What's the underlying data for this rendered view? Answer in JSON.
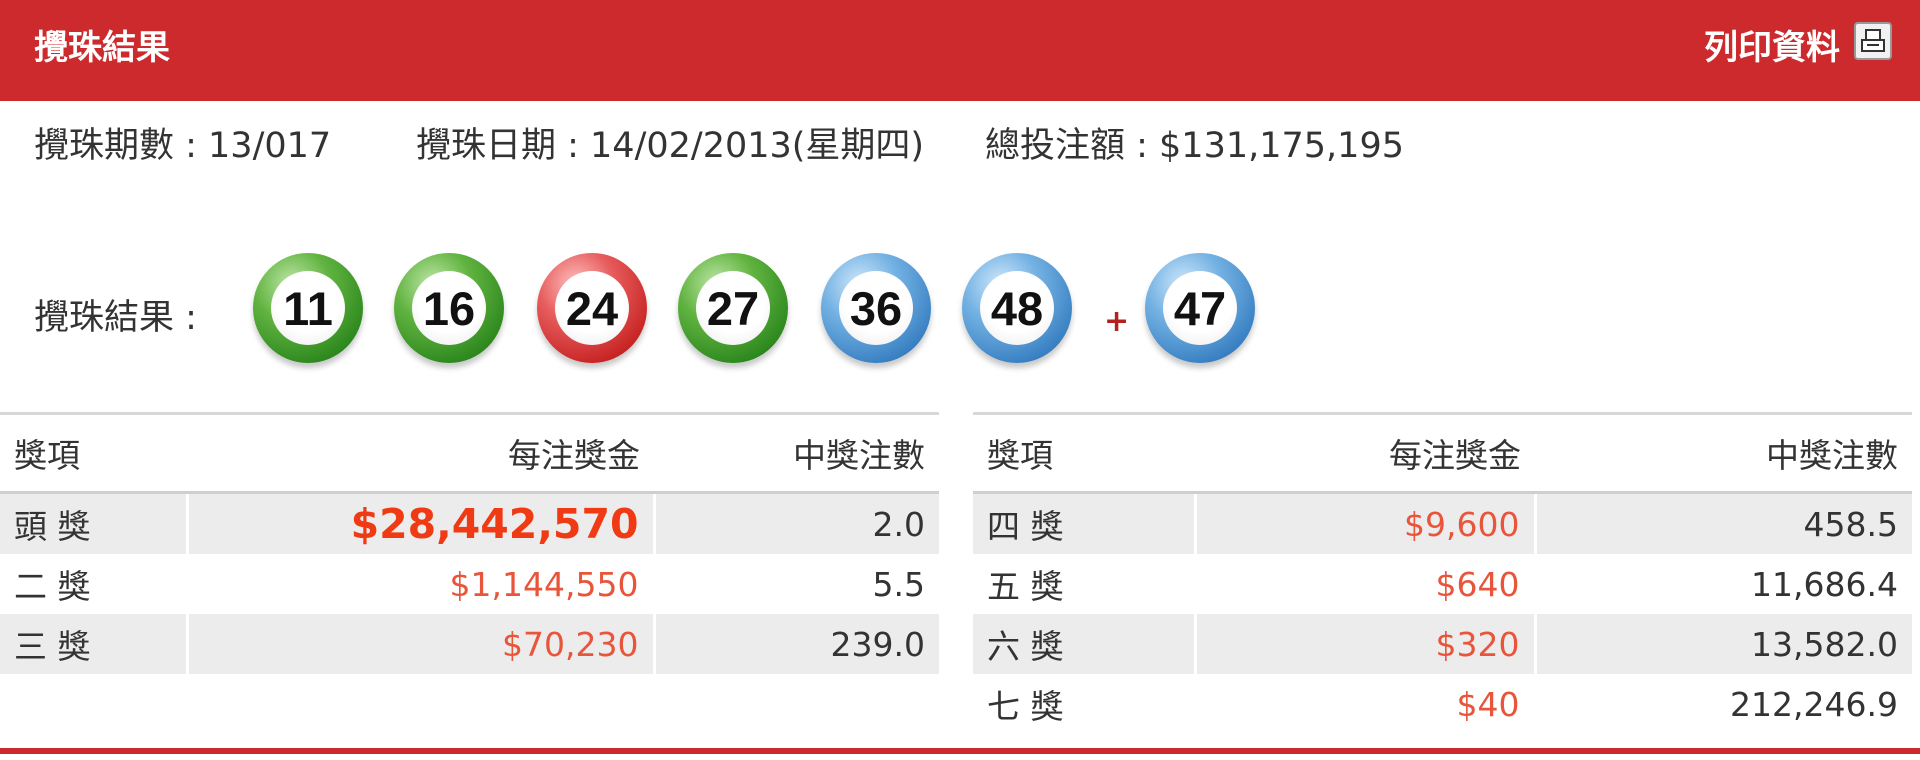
{
  "header": {
    "title": "攪珠結果",
    "print_label": "列印資料",
    "print_icon": "printer-icon"
  },
  "info": {
    "draw_no": "攪珠期數 : 13/017",
    "draw_date": "攪珠日期 : 14/02/2013(星期四)",
    "turnover": "總投注額 : $131,175,195"
  },
  "results": {
    "label": "攪珠結果 :",
    "balls": [
      {
        "number": "11",
        "color": "green"
      },
      {
        "number": "16",
        "color": "green"
      },
      {
        "number": "24",
        "color": "red"
      },
      {
        "number": "27",
        "color": "green"
      },
      {
        "number": "36",
        "color": "blue"
      },
      {
        "number": "48",
        "color": "blue"
      }
    ],
    "plus": "+",
    "extra": {
      "number": "47",
      "color": "blue"
    }
  },
  "tables": {
    "headers": [
      "獎項",
      "每注獎金",
      "中獎注數"
    ],
    "left": [
      {
        "name": "頭 獎",
        "amount": "$28,442,570",
        "count": "2.0"
      },
      {
        "name": "二 獎",
        "amount": "$1,144,550",
        "count": "5.5"
      },
      {
        "name": "三 獎",
        "amount": "$70,230",
        "count": "239.0"
      }
    ],
    "right": [
      {
        "name": "四 獎",
        "amount": "$9,600",
        "count": "458.5"
      },
      {
        "name": "五 獎",
        "amount": "$640",
        "count": "11,686.4"
      },
      {
        "name": "六 獎",
        "amount": "$320",
        "count": "13,582.0"
      },
      {
        "name": "七 獎",
        "amount": "$40",
        "count": "212,246.9"
      }
    ]
  },
  "colors": {
    "header_bg": "#cc2a2c",
    "prize_amount": "#e8553a"
  }
}
